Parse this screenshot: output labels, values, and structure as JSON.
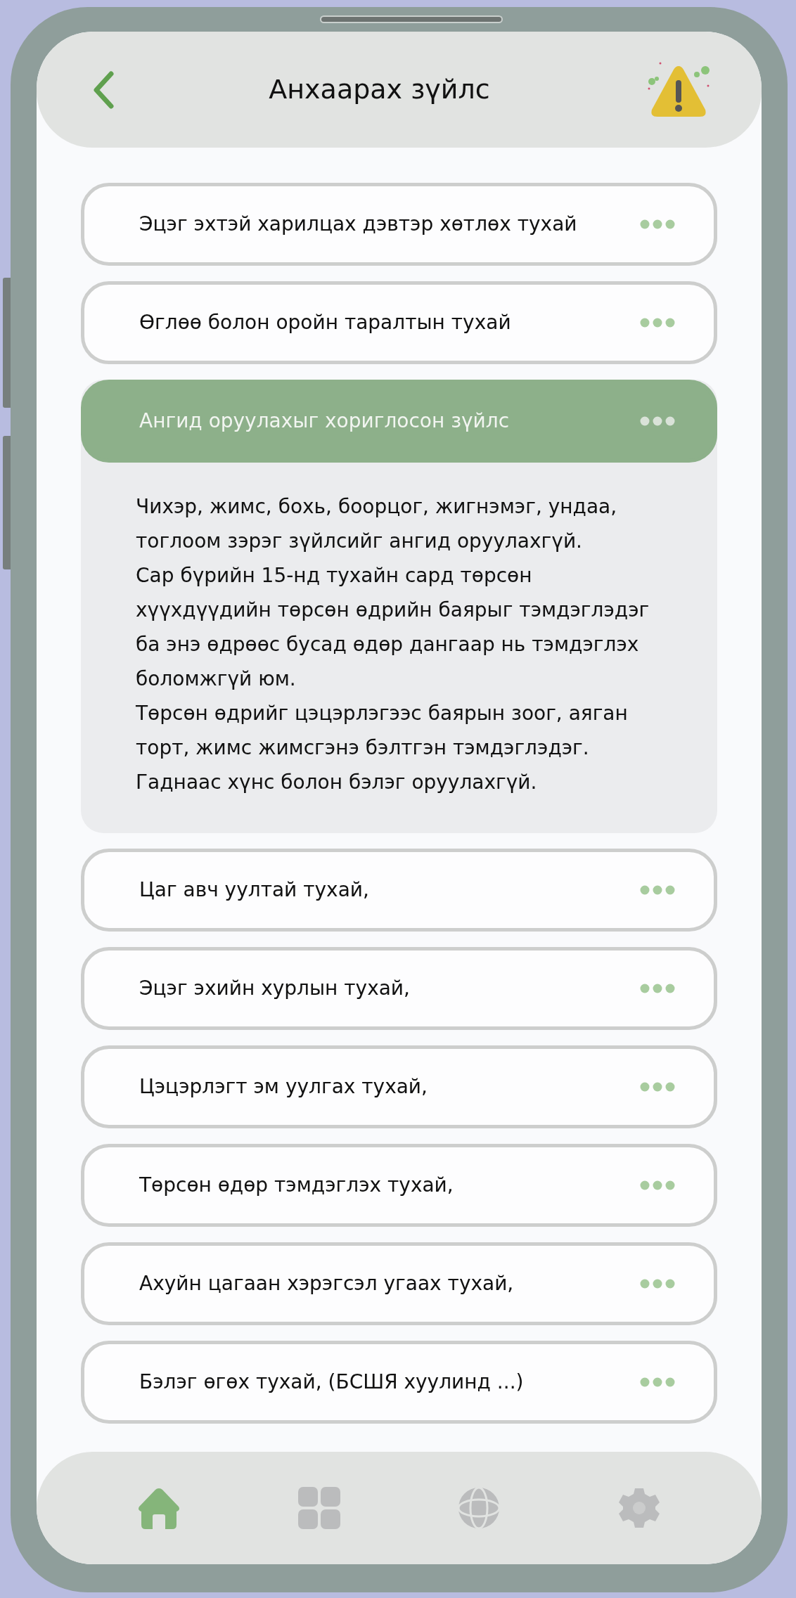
{
  "header": {
    "title": "Анхаарах зүйлс"
  },
  "items": [
    {
      "title": "Эцэг эхтэй харилцах дэвтэр хөтлөх тухай",
      "expanded": false
    },
    {
      "title": "Өглөө болон оройн таралтын тухай",
      "expanded": false
    },
    {
      "title": "Ангид оруулахыг хориглосон зүйлс",
      "expanded": true,
      "paragraphs": [
        "Чихэр, жимс, бохь, боорцог, жигнэмэг, ундаа, тоглоом зэрэг зүйлсийг ангид оруулахгүй.",
        "Сар бүрийн 15-нд тухайн сард төрсөн хүүхдүүдийн төрсөн өдрийн баярыг тэмдэглэдэг ба энэ өдрөөс бусад өдөр дангаар нь тэмдэглэх боломжгүй юм.",
        "Төрсөн өдрийг цэцэрлэгээс баярын зоог, аяган торт, жимс жимсгэнэ бэлтгэн тэмдэглэдэг. Гаднаас хүнс болон бэлэг оруулахгүй."
      ]
    },
    {
      "title": "Цаг авч уултай тухай,",
      "expanded": false
    },
    {
      "title": "Эцэг эхийн хурлын тухай,",
      "expanded": false
    },
    {
      "title": "Цэцэрлэгт эм уулгах тухай,",
      "expanded": false
    },
    {
      "title": "Төрсөн өдөр тэмдэглэх тухай,",
      "expanded": false
    },
    {
      "title": "Ахуйн цагаан хэрэгсэл угаах тухай,",
      "expanded": false
    },
    {
      "title": "Бэлэг өгөх тухай, (БСШЯ хуулинд ...)",
      "expanded": false
    }
  ],
  "nav": [
    {
      "kind": "home",
      "selected": true
    },
    {
      "kind": "grid",
      "selected": false
    },
    {
      "kind": "globe",
      "selected": false
    },
    {
      "kind": "settings",
      "selected": false
    }
  ]
}
